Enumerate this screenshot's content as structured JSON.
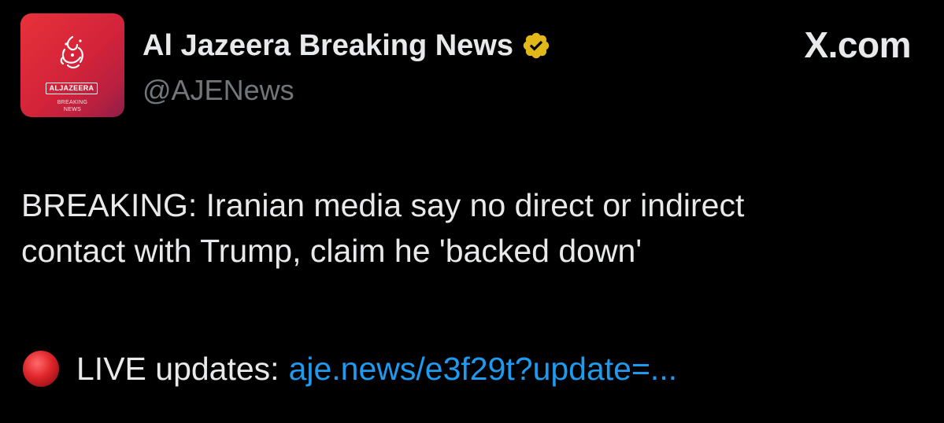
{
  "account": {
    "display_name": "Al Jazeera Breaking News",
    "handle": "@AJENews",
    "verified": true,
    "verified_color": "#e2b719",
    "avatar": {
      "brand": "ALJAZEERA",
      "sub_line1": "BREAKING",
      "sub_line2": "NEWS",
      "color": "#d8263a"
    }
  },
  "site_label": "X.com",
  "tweet": {
    "text_line1": "BREAKING: Iranian media say no direct or indirect",
    "text_line2": "contact with Trump, claim he 'backed down'",
    "live_icon": "red-circle-icon",
    "live_label": "LIVE updates:",
    "link_text": "aje.news/e3f29t?update=..."
  },
  "colors": {
    "background": "#000000",
    "text": "#e7e9ea",
    "secondary_text": "#71767b",
    "link": "#1d9bf0",
    "live_dot": "#e0262b"
  }
}
